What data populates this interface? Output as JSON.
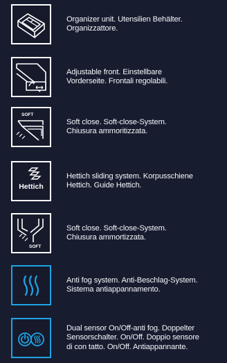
{
  "features": [
    {
      "icon": "organizer-unit-icon",
      "text": "Organizer unit. Utensilien Behälter.\nOrganizzattore."
    },
    {
      "icon": "adjustable-front-icon",
      "text": "Adjustable front. Einstellbare\nVorderseite. Frontali regolabili."
    },
    {
      "icon": "soft-close-drawer-icon",
      "icon_label": "SOFT",
      "text": "Soft close. Soft-close-System.\nChiusura ammoritizzata."
    },
    {
      "icon": "hettich-logo-icon",
      "icon_label": "Hettich",
      "text": "Hettich sliding system. Korpusschiene\nHettich. Guide Hettich."
    },
    {
      "icon": "soft-close-hinge-icon",
      "icon_label": "SOFT",
      "text": "Soft close. Soft-close-System.\nChiusura ammortizzata."
    },
    {
      "icon": "anti-fog-icon",
      "text": "Anti fog system. Anti-Beschlag-System.\nSistema antiappannamento."
    },
    {
      "icon": "dual-sensor-icon",
      "text": "Dual sensor On/Off-anti fog. Doppelter\nSensorschalter. On/Off. Doppio sensore\ndi con tatto. On/Off. Antiappannante."
    }
  ],
  "colors": {
    "background": "#171c2f",
    "border": "#ffffff",
    "accent": "#1fa3e6"
  }
}
